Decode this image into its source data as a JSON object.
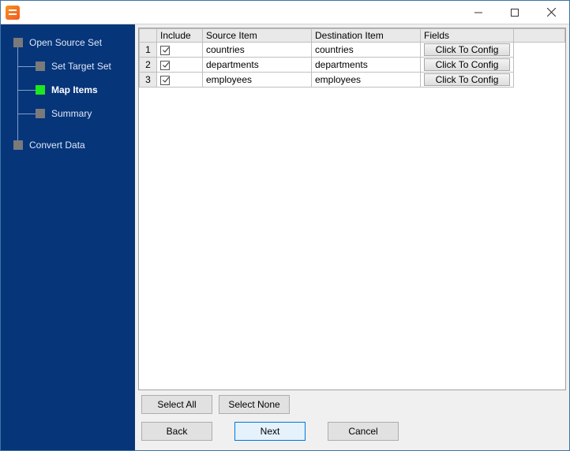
{
  "window": {
    "title": ""
  },
  "sidebar": {
    "items": [
      {
        "label": "Open Source Set",
        "level": "top",
        "active": false
      },
      {
        "label": "Set Target Set",
        "level": "child",
        "active": false
      },
      {
        "label": "Map Items",
        "level": "child",
        "active": true
      },
      {
        "label": "Summary",
        "level": "child",
        "active": false
      },
      {
        "label": "Convert Data",
        "level": "top",
        "active": false
      }
    ]
  },
  "grid": {
    "headers": {
      "rownum": "",
      "include": "Include",
      "source": "Source Item",
      "dest": "Destination Item",
      "fields": "Fields"
    },
    "config_button_label": "Click To Config",
    "rows": [
      {
        "n": "1",
        "include": true,
        "source": "countries",
        "dest": "countries"
      },
      {
        "n": "2",
        "include": true,
        "source": "departments",
        "dest": "departments"
      },
      {
        "n": "3",
        "include": true,
        "source": "employees",
        "dest": "employees"
      }
    ]
  },
  "buttons": {
    "select_all": "Select All",
    "select_none": "Select None",
    "back": "Back",
    "next": "Next",
    "cancel": "Cancel"
  }
}
